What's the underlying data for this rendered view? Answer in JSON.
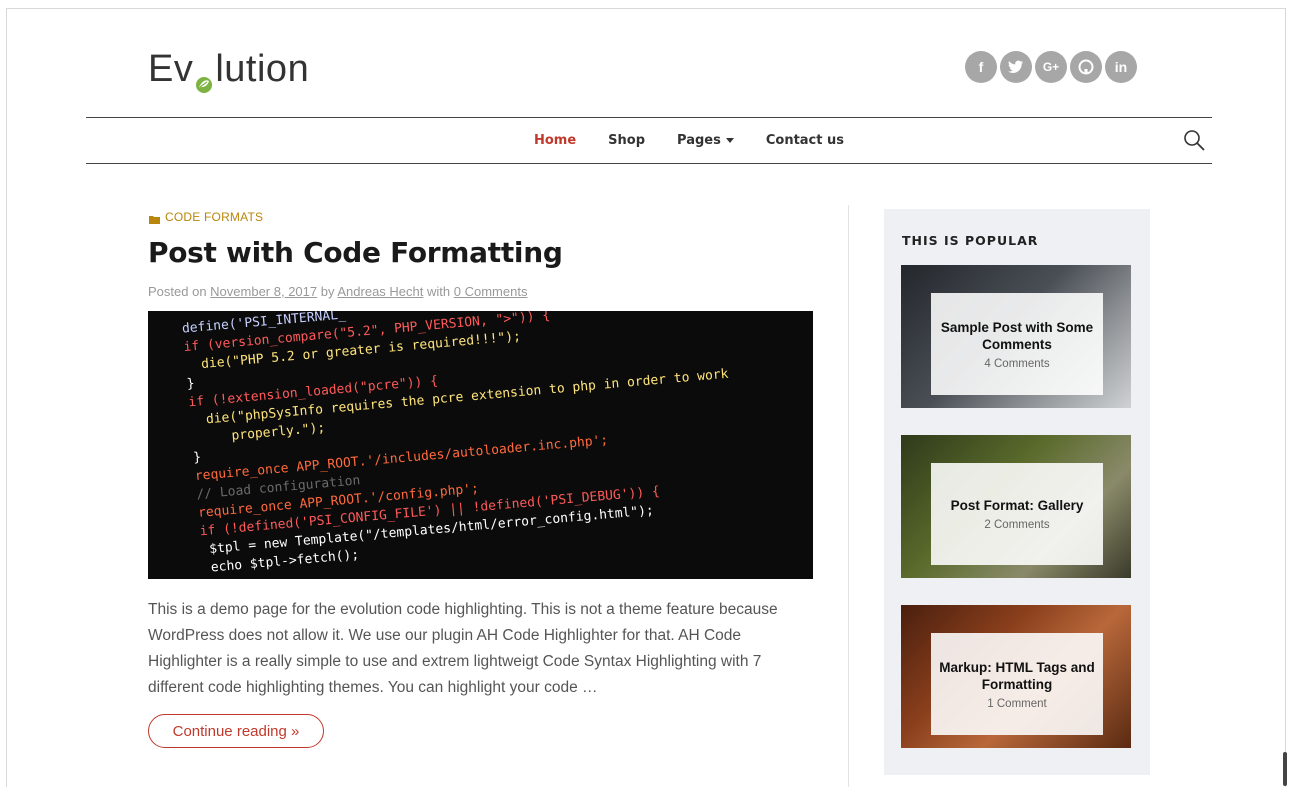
{
  "site": {
    "logo_prefix": "Ev",
    "logo_suffix": "lution",
    "social": [
      {
        "icon": "facebook-icon",
        "glyph": "f"
      },
      {
        "icon": "twitter-icon",
        "glyph": "t"
      },
      {
        "icon": "google-plus-icon",
        "glyph": "G+"
      },
      {
        "icon": "github-icon",
        "glyph": "gh"
      },
      {
        "icon": "linkedin-icon",
        "glyph": "in"
      }
    ]
  },
  "nav": {
    "items": [
      {
        "label": "Home",
        "active": true
      },
      {
        "label": "Shop"
      },
      {
        "label": "Pages",
        "dropdown": true
      },
      {
        "label": "Contact us"
      }
    ]
  },
  "post": {
    "category": "CODE FORMATS",
    "title": "Post with Code Formatting",
    "meta_posted": "Posted on",
    "meta_date": "November 8, 2017",
    "meta_by": "by",
    "meta_author": "Andreas Hecht",
    "meta_with": "with",
    "meta_comments": "0 Comments",
    "code_lines": [
      "define('PSI_INTERNAL_",
      "if (version_compare(\"5.2\", PHP_VERSION, \">\")) {",
      "    die(\"PHP 5.2 or greater is required!!!\");",
      "}",
      "if (!extension_loaded(\"pcre\")) {",
      "    die(\"phpSysInfo requires the pcre extension to php in order to work",
      "        properly.\");",
      "}",
      "require_once APP_ROOT.'/includes/autoloader.inc.php';",
      "// Load configuration",
      "require_once APP_ROOT.'/config.php';",
      "if (!defined('PSI_CONFIG_FILE') || !defined('PSI_DEBUG')) {",
      "    $tpl = new Template(\"/templates/html/error_config.html\");",
      "    echo $tpl->fetch();"
    ],
    "excerpt": "This is a demo page for the evolution code highlighting. This is not a theme feature because WordPress does not allow it. We use our plugin AH Code Highlighter for that. AH Code Highlighter is a really simple to use and extrem lightweigt Code Syntax Highlighting with 7 different code highlighting themes. You can highlight your code …",
    "continue_label": "Continue reading »"
  },
  "sidebar": {
    "title": "THIS IS POPULAR",
    "items": [
      {
        "title": "Sample Post with Some Comments",
        "comments": "4 Comments",
        "bg": "#3b3f44"
      },
      {
        "title": "Post Format: Gallery",
        "comments": "2 Comments",
        "bg": "#4a5a2c"
      },
      {
        "title": "Markup: HTML Tags and Formatting",
        "comments": "1 Comment",
        "bg": "#7a3a1c"
      }
    ]
  },
  "colors": {
    "accent": "#c0392b",
    "category": "#b8860b",
    "logo_leaf": "#7cb342"
  }
}
